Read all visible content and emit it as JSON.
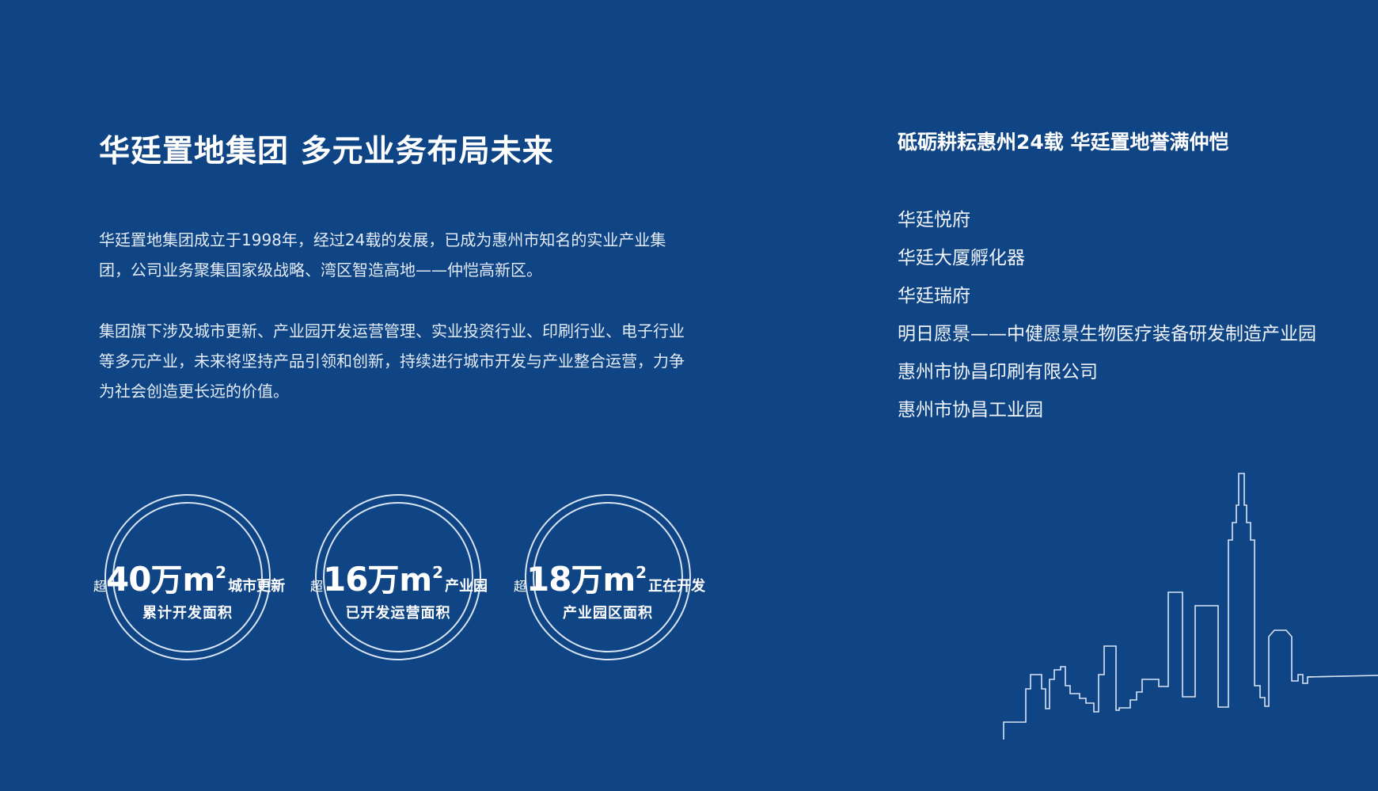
{
  "title": "华廷置地集团 多元业务布局未来",
  "paragraphs": [
    "华廷置地集团成立于1998年，经过24载的发展，已成为惠州市知名的实业产业集团，公司业务聚集国家级战略、湾区智造高地——仲恺高新区。",
    "集团旗下涉及城市更新、产业园开发运营管理、实业投资行业、印刷行业、电子行业等多元产业，未来将坚持产品引领和创新，持续进行城市开发与产业整合运营，力争为社会创造更长远的价值。"
  ],
  "right_panel": {
    "title": "砥砺耕耘惠州24载  华廷置地誉满仲恺",
    "items": [
      "华廷悦府",
      "华廷大厦孵化器",
      "华廷瑞府",
      "明日愿景——中健愿景生物医疗装备研发制造产业园",
      "惠州市协昌印刷有限公司",
      "惠州市协昌工业园"
    ]
  },
  "stats": [
    {
      "prefix": "超",
      "value": "40",
      "unit": "万",
      "unit_symbol": "m",
      "superscript": "2",
      "label": "城市更新",
      "sub": "累计开发面积"
    },
    {
      "prefix": "超",
      "value": "16",
      "unit": "万",
      "unit_symbol": "m",
      "superscript": "2",
      "label": "产业园",
      "sub": "已开发运营面积"
    },
    {
      "prefix": "超",
      "value": "18",
      "unit": "万",
      "unit_symbol": "m",
      "superscript": "2",
      "label": "正在开发",
      "sub": "产业园区面积"
    }
  ],
  "colors": {
    "background": "#0f4485",
    "text": "#ffffff",
    "line": "#d9e4f3"
  }
}
